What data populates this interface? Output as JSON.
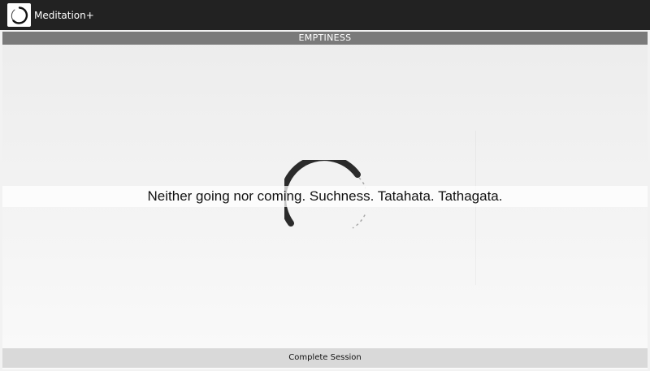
{
  "app_bar": {
    "title": "Meditation+",
    "icon": "enso-circle-icon"
  },
  "content": {
    "section_title": "EMPTINESS",
    "quote": "Neither going nor coming. Suchness. Tatahata. Tathagata.",
    "spinner_icon": "enso-spinner-icon"
  },
  "footer": {
    "complete_label": "Complete Session"
  },
  "colors": {
    "app_bar": "#222222",
    "section_header": "#7a7a7a",
    "button": "#d9d9d9",
    "text": "#111111"
  }
}
